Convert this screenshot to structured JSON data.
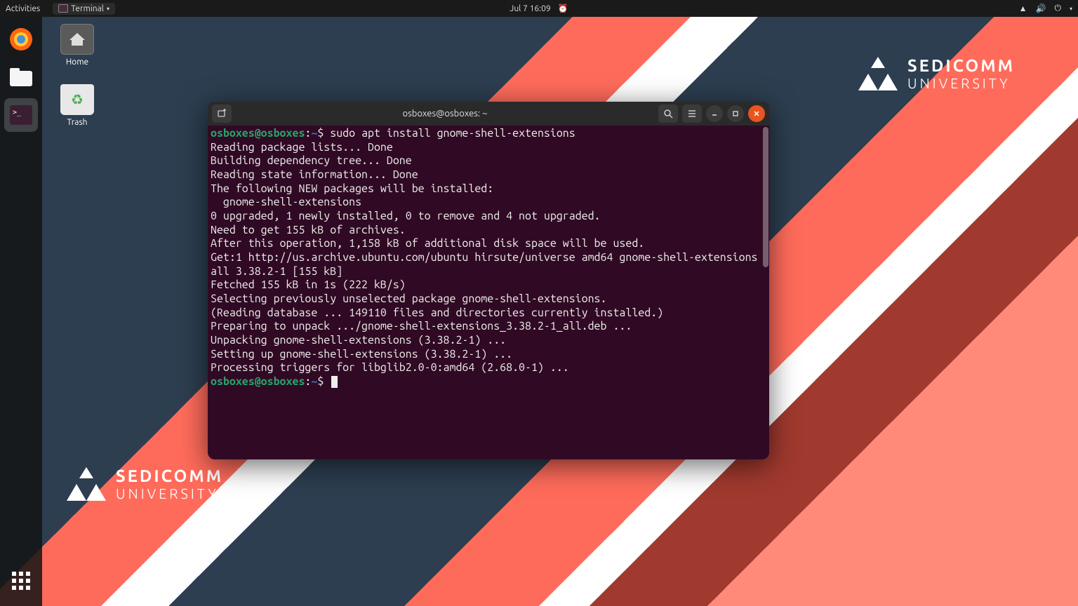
{
  "topbar": {
    "activities": "Activities",
    "app_name": "Terminal",
    "datetime": "Jul 7  16:09"
  },
  "desktop": {
    "home_label": "Home",
    "trash_label": "Trash"
  },
  "logo": {
    "line1": "SEDICOMM",
    "line2": "UNIVERSITY"
  },
  "terminal": {
    "title": "osboxes@osboxes: ~",
    "prompt_user": "osboxes@osboxes",
    "prompt_sep": ":",
    "prompt_path": "~",
    "prompt_dollar": "$",
    "command": "sudo apt install gnome-shell-extensions",
    "lines": [
      "Reading package lists... Done",
      "Building dependency tree... Done",
      "Reading state information... Done",
      "The following NEW packages will be installed:",
      "  gnome-shell-extensions",
      "0 upgraded, 1 newly installed, 0 to remove and 4 not upgraded.",
      "Need to get 155 kB of archives.",
      "After this operation, 1,158 kB of additional disk space will be used.",
      "Get:1 http://us.archive.ubuntu.com/ubuntu hirsute/universe amd64 gnome-shell-extensions all 3.38.2-1 [155 kB]",
      "Fetched 155 kB in 1s (222 kB/s)",
      "Selecting previously unselected package gnome-shell-extensions.",
      "(Reading database ... 149110 files and directories currently installed.)",
      "Preparing to unpack .../gnome-shell-extensions_3.38.2-1_all.deb ...",
      "Unpacking gnome-shell-extensions (3.38.2-1) ...",
      "Setting up gnome-shell-extensions (3.38.2-1) ...",
      "Processing triggers for libglib2.0-0:amd64 (2.68.0-1) ..."
    ]
  }
}
